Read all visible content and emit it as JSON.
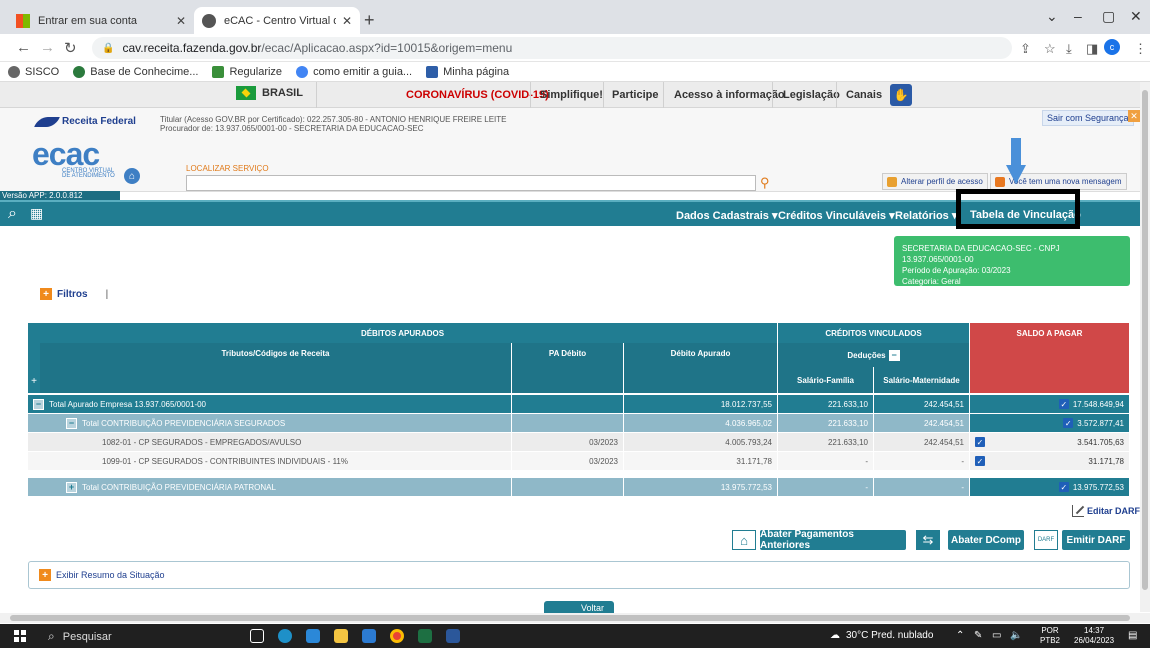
{
  "browser": {
    "tabs": [
      {
        "label": "Entrar em sua conta",
        "active": false
      },
      {
        "label": "eCAC - Centro Virtual de Atendimento",
        "active": true
      }
    ],
    "url_host": "cav.receita.fazenda.gov.br",
    "url_path": "/ecac/Aplicacao.aspx?id=10015&origem=menu",
    "bookmarks": [
      "SISCO",
      "Base de Conhecime...",
      "Regularize",
      "como emitir a guia...",
      "Minha página"
    ]
  },
  "govbar": {
    "brasil": "BRASIL",
    "links": [
      "CORONAVÍRUS (COVID-19)",
      "Simplifique!",
      "Participe",
      "Acesso à informação",
      "Legislação",
      "Canais"
    ]
  },
  "header": {
    "logo": "Receita Federal",
    "titular_line1": "Titular (Acesso GOV.BR por Certificado): 022.257.305-80 - ANTONIO HENRIQUE FREIRE LEITE",
    "titular_line2": "Procurador de: 13.937.065/0001-00 - SECRETARIA DA EDUCACAO-SEC",
    "ecac": "ecac",
    "ecac_sub1": "CENTRO VIRTUAL",
    "ecac_sub2": "DE ATENDIMENTO",
    "localizar_label": "LOCALIZAR SERVIÇO",
    "sair": "Sair com Segurança",
    "alterar_perfil": "Alterar perfil de acesso",
    "mensagem": "Você tem uma nova mensagem",
    "versao": "Versão APP: 2.0.0.812"
  },
  "nav": {
    "items": [
      "Dados Cadastrais ▾",
      "Créditos Vinculáveis ▾",
      "Relatórios ▾",
      "Tabela de Vinculação"
    ]
  },
  "info": {
    "line1": "SECRETARIA DA EDUCACAO-SEC - CNPJ 13.937.065/0001-00",
    "line2": "Período de Apuração: 03/2023",
    "line3": "Categoria: Geral"
  },
  "filtros": "Filtros",
  "table": {
    "h_debitos": "DÉBITOS APURADOS",
    "h_creditos": "CRÉDITOS VINCULADOS",
    "h_saldo": "SALDO A PAGAR",
    "h_tributos": "Tributos/Códigos de Receita",
    "h_pa": "PA Débito",
    "h_debito": "Débito Apurado",
    "h_deducoes": "Deduções",
    "h_sal_familia": "Salário-Família",
    "h_sal_maternidade": "Salário-Maternidade",
    "rows": [
      {
        "desc": "Total Apurado Empresa 13.937.065/0001-00",
        "pa": "",
        "debito": "18.012.737,55",
        "familia": "221.633,10",
        "maternidade": "242.454,51",
        "saldo": "17.548.649,94"
      },
      {
        "desc": "Total CONTRIBUIÇÃO PREVIDENCIÁRIA SEGURADOS",
        "pa": "",
        "debito": "4.036.965,02",
        "familia": "221.633,10",
        "maternidade": "242.454,51",
        "saldo": "3.572.877,41"
      },
      {
        "desc": "1082-01 - CP SEGURADOS - EMPREGADOS/AVULSO",
        "pa": "03/2023",
        "debito": "4.005.793,24",
        "familia": "221.633,10",
        "maternidade": "242.454,51",
        "saldo": "3.541.705,63"
      },
      {
        "desc": "1099-01 - CP SEGURADOS - CONTRIBUINTES INDIVIDUAIS - 11%",
        "pa": "03/2023",
        "debito": "31.171,78",
        "familia": "-",
        "maternidade": "-",
        "saldo": "31.171,78"
      },
      {
        "desc": "Total CONTRIBUIÇÃO PREVIDENCIÁRIA PATRONAL",
        "pa": "",
        "debito": "13.975.772,53",
        "familia": "-",
        "maternidade": "-",
        "saldo": "13.975.772,53"
      }
    ]
  },
  "actions": {
    "editar": "Editar DARF",
    "abater_pag": "Abater Pagamentos Anteriores",
    "abater_dcomp": "Abater DComp",
    "darf_badge": "DARF",
    "emitir": "Emitir DARF"
  },
  "resumo": "Exibir Resumo da Situação",
  "voltar": "Voltar",
  "taskbar": {
    "search": "Pesquisar",
    "weather": "30°C  Pred. nublado",
    "lang1": "POR",
    "lang2": "PTB2",
    "time": "14:37",
    "date": "26/04/2023"
  },
  "colors": {
    "primary": "#217d92",
    "saldo": "#d04848",
    "info": "#3dbd6e",
    "accent": "#f08a1c"
  }
}
